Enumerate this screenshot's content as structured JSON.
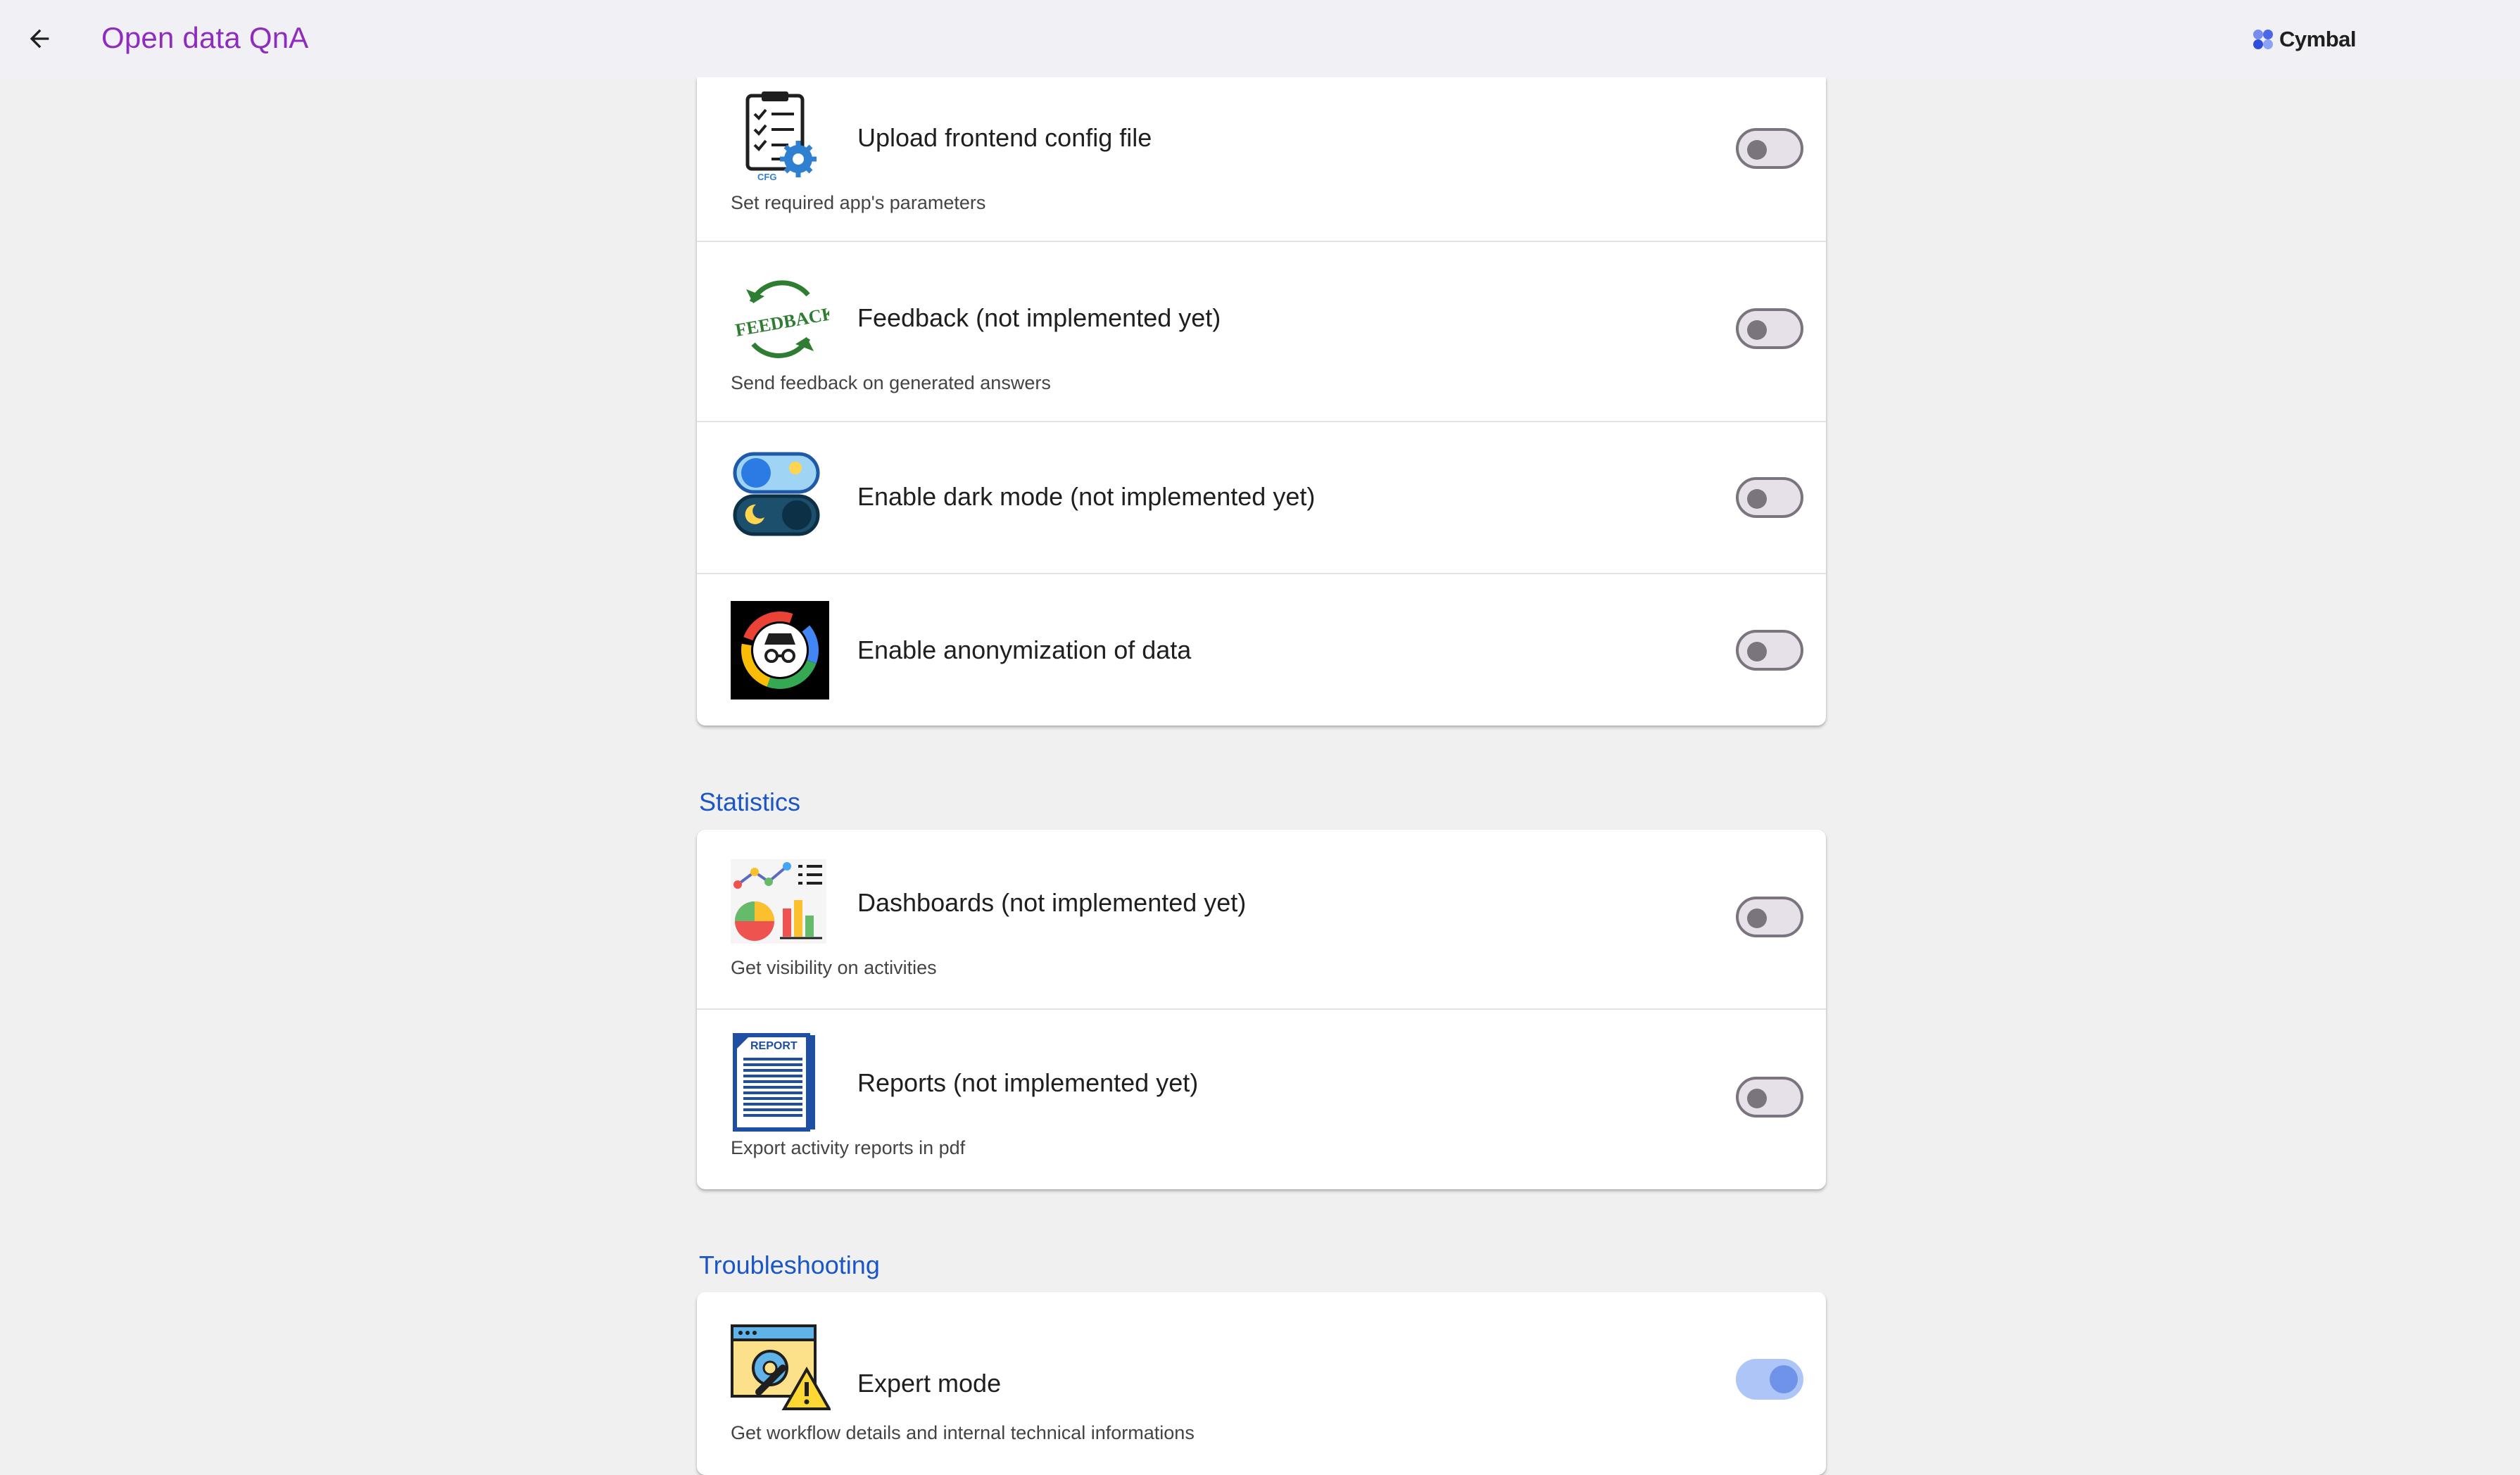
{
  "header": {
    "title": "Open data QnA",
    "back_icon": "arrow-back-icon",
    "logo_text": "Cymbal",
    "accent_color": "#8e2cbf"
  },
  "settings_groups": [
    {
      "name": "",
      "items": [
        {
          "title": "Upload frontend config file",
          "subtitle": "Set required app's parameters",
          "enabled": false,
          "icon": "config-checklist-icon",
          "icon_caption": "CFG"
        },
        {
          "title": "Feedback (not implemented yet)",
          "subtitle": "Send feedback on generated answers",
          "enabled": false,
          "icon": "feedback-icon",
          "icon_caption": "FEEDBACK"
        },
        {
          "title": "Enable dark mode (not implemented yet)",
          "subtitle": "",
          "enabled": false,
          "icon": "day-night-toggle-icon"
        },
        {
          "title": "Enable anonymization of data",
          "subtitle": "",
          "enabled": false,
          "icon": "incognito-icon"
        }
      ]
    },
    {
      "name": "Statistics",
      "items": [
        {
          "title": "Dashboards (not implemented yet)",
          "subtitle": "Get visibility on activities",
          "enabled": false,
          "icon": "dashboard-charts-icon"
        },
        {
          "title": "Reports (not implemented yet)",
          "subtitle": "Export activity reports in pdf",
          "enabled": false,
          "icon": "report-document-icon",
          "icon_caption": "REPORT"
        }
      ]
    },
    {
      "name": "Troubleshooting",
      "items": [
        {
          "title": "Expert mode",
          "subtitle": "Get workflow details and internal technical informations",
          "enabled": true,
          "icon": "expert-tools-warning-icon"
        }
      ]
    }
  ],
  "colors": {
    "section_title": "#1a56c6",
    "toggle_on": "#6f93e8",
    "toggle_off": "#79747e"
  }
}
